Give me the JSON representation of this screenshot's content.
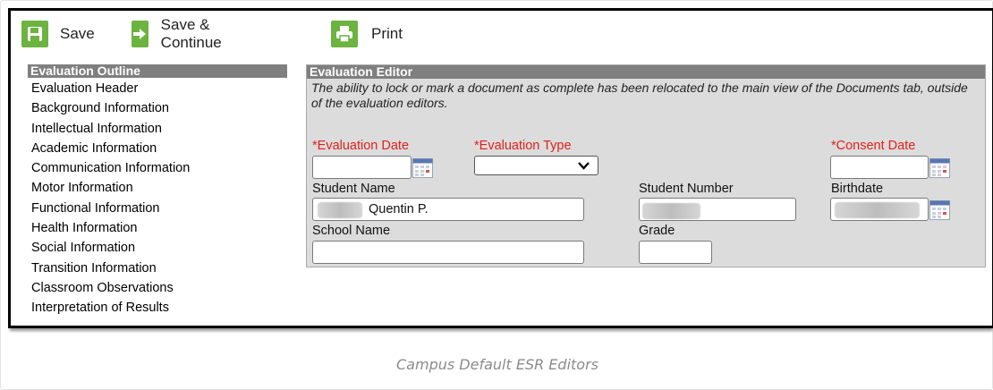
{
  "toolbar": {
    "save_label": "Save",
    "save_continue_label": "Save & Continue",
    "print_label": "Print",
    "icon_color": "#6cb33f"
  },
  "outline": {
    "title": "Evaluation Outline",
    "items": [
      {
        "label": "Evaluation Header"
      },
      {
        "label": "Background Information"
      },
      {
        "label": "Intellectual Information"
      },
      {
        "label": "Academic Information"
      },
      {
        "label": "Communication Information"
      },
      {
        "label": "Motor Information"
      },
      {
        "label": "Functional Information"
      },
      {
        "label": "Health Information"
      },
      {
        "label": "Social Information"
      },
      {
        "label": "Transition Information"
      },
      {
        "label": "Classroom Observations"
      },
      {
        "label": "Interpretation of Results"
      }
    ]
  },
  "editor": {
    "title": "Evaluation Editor",
    "note": "The ability to lock or mark a document as complete has been relocated to the main view of the Documents tab, outside of the evaluation editors.",
    "fields": {
      "evaluation_date_label": "*Evaluation Date",
      "evaluation_date_value": "",
      "evaluation_type_label": "*Evaluation Type",
      "evaluation_type_value": "",
      "consent_date_label": "*Consent Date",
      "consent_date_value": "",
      "student_name_label": "Student Name",
      "student_name_value": "Quentin P.",
      "student_number_label": "Student Number",
      "birthdate_label": "Birthdate",
      "school_name_label": "School Name",
      "school_name_value": "",
      "grade_label": "Grade",
      "grade_value": ""
    },
    "required_color": "#e0201a",
    "header_color": "#7f7f7f",
    "background_color": "#dcdcdc"
  },
  "caption": "Campus Default ESR Editors"
}
